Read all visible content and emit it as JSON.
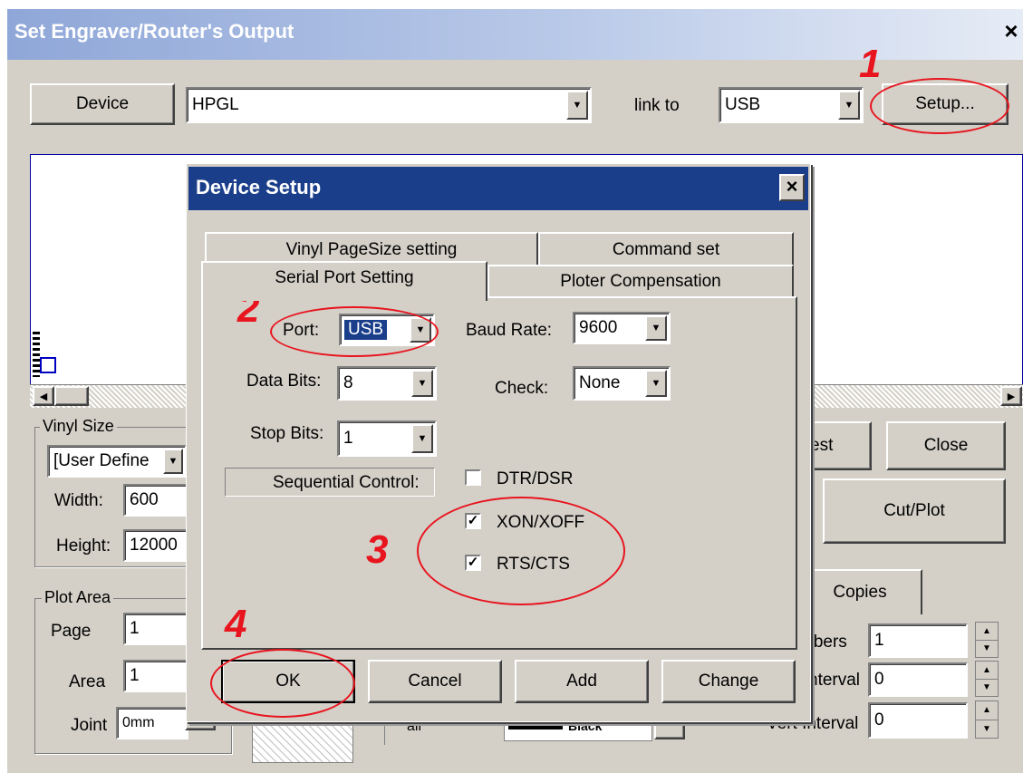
{
  "window": {
    "title": "Set Engraver/Router's Output",
    "close_glyph": "×"
  },
  "toolbar": {
    "device_button": "Device",
    "device_value": "HPGL",
    "link_to_label": "link to",
    "link_value": "USB",
    "setup_button": "Setup..."
  },
  "vinyl_size": {
    "group_label": "Vinyl Size",
    "preset": "[User Define",
    "width_label": "Width:",
    "width_value": "600",
    "height_label": "Height:",
    "height_value": "12000"
  },
  "plot_area": {
    "group_label": "Plot Area",
    "page_label": "Page",
    "page_value": "1",
    "area_label": "Area",
    "area_value": "1",
    "joint_label": "Joint",
    "joint_value": "0mm"
  },
  "right_panel": {
    "test_button": "est",
    "close_button": "Close",
    "cutplot_button": "Cut/Plot",
    "copies_tab": "Copies",
    "numbers_label": "mbers",
    "numbers_value": "1",
    "horz_label": "nterval",
    "horz_value": "0",
    "vert_label": "Vert Interval",
    "vert_value": "0"
  },
  "bottom": {
    "fill_label": "all",
    "color_label": "Black"
  },
  "dialog": {
    "title": "Device Setup",
    "close_glyph": "×",
    "tabs": {
      "vinyl_pagesize": "Vinyl PageSize setting",
      "command_set": "Command set",
      "serial_port": "Serial Port Setting",
      "ploter_compensation": "Ploter Compensation"
    },
    "port_label": "Port:",
    "port_value": "USB",
    "baud_label": "Baud Rate:",
    "baud_value": "9600",
    "data_bits_label": "Data Bits:",
    "data_bits_value": "8",
    "check_label": "Check:",
    "check_value": "None",
    "stop_bits_label": "Stop Bits:",
    "stop_bits_value": "1",
    "sequential_label": "Sequential Control:",
    "controls": [
      {
        "label": "DTR/DSR",
        "checked": false
      },
      {
        "label": "XON/XOFF",
        "checked": true
      },
      {
        "label": "RTS/CTS",
        "checked": true
      }
    ],
    "buttons": {
      "ok": "OK",
      "cancel": "Cancel",
      "add": "Add",
      "change": "Change"
    }
  },
  "annotations": {
    "step1": "1",
    "step2": "2",
    "step3": "3",
    "step4": "4",
    "color": "#e8141e"
  },
  "icons": {
    "dropdown": "combo-arrow-icon",
    "checkmark": "checkmark-icon",
    "spin": "spin-updown-icon",
    "scroll_left": "scroll-left-icon",
    "scroll_right": "scroll-right-icon"
  }
}
